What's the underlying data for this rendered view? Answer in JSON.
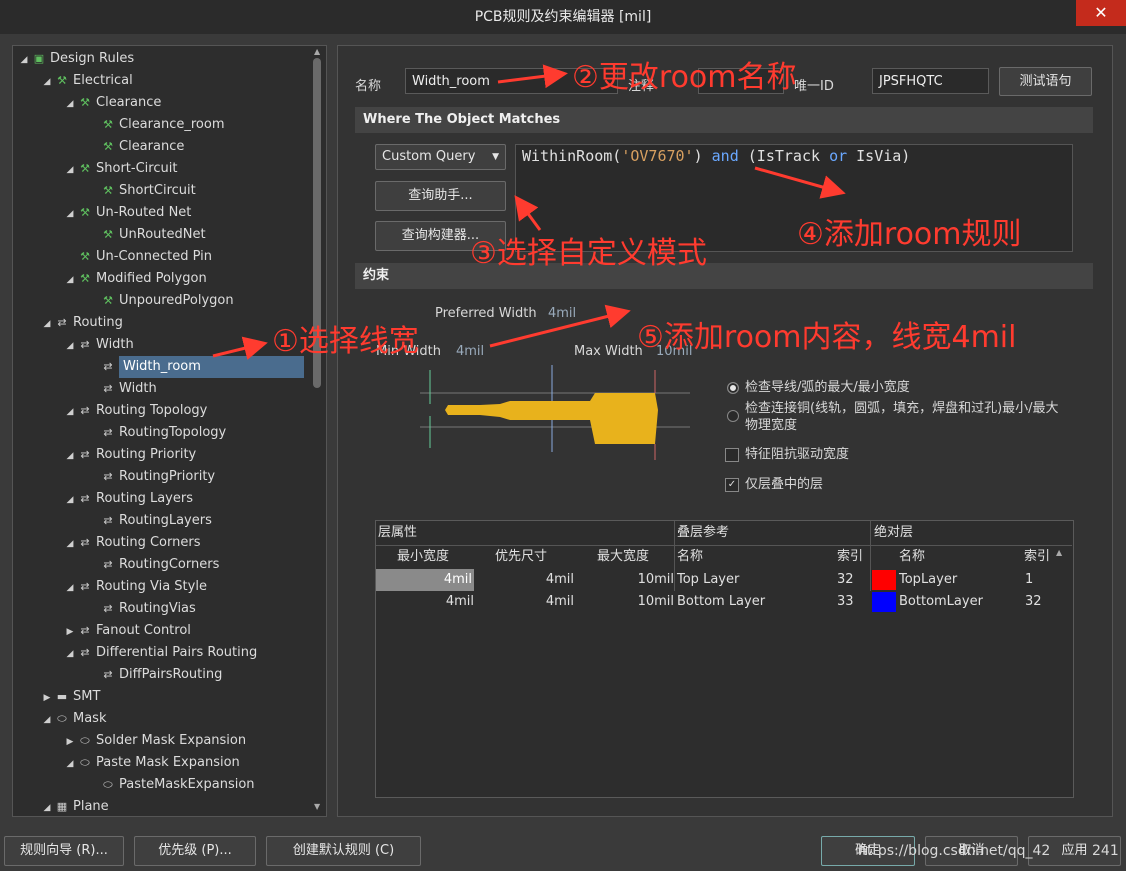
{
  "window": {
    "title": "PCB规则及约束编辑器 [mil]",
    "close": "✕"
  },
  "tree": [
    {
      "label": "Design Rules",
      "level": 0,
      "arrow": "◢",
      "icon": "rules-folder"
    },
    {
      "label": "Electrical",
      "level": 1,
      "arrow": "◢",
      "icon": "rule"
    },
    {
      "label": "Clearance",
      "level": 2,
      "arrow": "◢",
      "icon": "rule"
    },
    {
      "label": "Clearance_room",
      "level": 3,
      "arrow": "",
      "icon": "rule"
    },
    {
      "label": "Clearance",
      "level": 3,
      "arrow": "",
      "icon": "rule"
    },
    {
      "label": "Short-Circuit",
      "level": 2,
      "arrow": "◢",
      "icon": "rule"
    },
    {
      "label": "ShortCircuit",
      "level": 3,
      "arrow": "",
      "icon": "rule"
    },
    {
      "label": "Un-Routed Net",
      "level": 2,
      "arrow": "◢",
      "icon": "rule"
    },
    {
      "label": "UnRoutedNet",
      "level": 3,
      "arrow": "",
      "icon": "rule"
    },
    {
      "label": "Un-Connected Pin",
      "level": 2,
      "arrow": "",
      "icon": "rule"
    },
    {
      "label": "Modified Polygon",
      "level": 2,
      "arrow": "◢",
      "icon": "rule"
    },
    {
      "label": "UnpouredPolygon",
      "level": 3,
      "arrow": "",
      "icon": "rule"
    },
    {
      "label": "Routing",
      "level": 1,
      "arrow": "◢",
      "icon": "routing"
    },
    {
      "label": "Width",
      "level": 2,
      "arrow": "◢",
      "icon": "routing"
    },
    {
      "label": "Width_room",
      "level": 3,
      "arrow": "",
      "icon": "routing",
      "selected": true
    },
    {
      "label": "Width",
      "level": 3,
      "arrow": "",
      "icon": "routing"
    },
    {
      "label": "Routing Topology",
      "level": 2,
      "arrow": "◢",
      "icon": "routing"
    },
    {
      "label": "RoutingTopology",
      "level": 3,
      "arrow": "",
      "icon": "routing"
    },
    {
      "label": "Routing Priority",
      "level": 2,
      "arrow": "◢",
      "icon": "routing"
    },
    {
      "label": "RoutingPriority",
      "level": 3,
      "arrow": "",
      "icon": "routing"
    },
    {
      "label": "Routing Layers",
      "level": 2,
      "arrow": "◢",
      "icon": "routing"
    },
    {
      "label": "RoutingLayers",
      "level": 3,
      "arrow": "",
      "icon": "routing"
    },
    {
      "label": "Routing Corners",
      "level": 2,
      "arrow": "◢",
      "icon": "routing"
    },
    {
      "label": "RoutingCorners",
      "level": 3,
      "arrow": "",
      "icon": "routing"
    },
    {
      "label": "Routing Via Style",
      "level": 2,
      "arrow": "◢",
      "icon": "routing"
    },
    {
      "label": "RoutingVias",
      "level": 3,
      "arrow": "",
      "icon": "routing"
    },
    {
      "label": "Fanout Control",
      "level": 2,
      "arrow": "▶",
      "icon": "routing"
    },
    {
      "label": "Differential Pairs Routing",
      "level": 2,
      "arrow": "◢",
      "icon": "routing"
    },
    {
      "label": "DiffPairsRouting",
      "level": 3,
      "arrow": "",
      "icon": "routing"
    },
    {
      "label": "SMT",
      "level": 1,
      "arrow": "▶",
      "icon": "smt"
    },
    {
      "label": "Mask",
      "level": 1,
      "arrow": "◢",
      "icon": "mask"
    },
    {
      "label": "Solder Mask Expansion",
      "level": 2,
      "arrow": "▶",
      "icon": "mask"
    },
    {
      "label": "Paste Mask Expansion",
      "level": 2,
      "arrow": "◢",
      "icon": "mask"
    },
    {
      "label": "PasteMaskExpansion",
      "level": 3,
      "arrow": "",
      "icon": "mask"
    },
    {
      "label": "Plane",
      "level": 1,
      "arrow": "◢",
      "icon": "plane"
    }
  ],
  "form": {
    "name_label": "名称",
    "name_value": "Width_room",
    "comment_label": "注释",
    "comment_value": "",
    "uid_label": "唯一ID",
    "uid_value": "JPSFHQTC",
    "test_button": "测试语句"
  },
  "where": {
    "header": "Where The Object Matches",
    "query_type": "Custom Query",
    "helper_button": "查询助手...",
    "builder_button": "查询构建器...",
    "query_parts": {
      "p1": "WithinRoom(",
      "p2": "'OV7670'",
      "p3": ") ",
      "p4": "and",
      "p5": " (IsTrack ",
      "p6": "or",
      "p7": " IsVia)"
    }
  },
  "constraints": {
    "header": "约束",
    "preferred_label": "Preferred Width",
    "preferred_value": "4mil",
    "min_label": "Min Width",
    "min_value": "4mil",
    "max_label": "Max Width",
    "max_value": "10mil",
    "opt1": "检查导线/弧的最大/最小宽度",
    "opt2a": "检查连接铜(线轨，圆弧，填充，焊盘和过孔)最小/最大",
    "opt2b": "物理宽度",
    "chk1": "特征阻抗驱动宽度",
    "chk2": "仅层叠中的层"
  },
  "table": {
    "group1": "层属性",
    "group2": "叠层参考",
    "group3": "绝对层",
    "cols": [
      "最小宽度",
      "优先尺寸",
      "最大宽度",
      "名称",
      "索引",
      "名称",
      "索引"
    ],
    "rows": [
      {
        "min": "4mil",
        "pref": "4mil",
        "max": "10mil",
        "stack_name": "Top Layer",
        "stack_idx": "32",
        "color": "#ff0000",
        "abs_name": "TopLayer",
        "abs_idx": "1"
      },
      {
        "min": "4mil",
        "pref": "4mil",
        "max": "10mil",
        "stack_name": "Bottom Layer",
        "stack_idx": "33",
        "color": "#0000ff",
        "abs_name": "BottomLayer",
        "abs_idx": "32"
      }
    ]
  },
  "footer": {
    "wizard": "规则向导 (R)...",
    "priority": "优先级 (P)...",
    "default_rules": "创建默认规则 (C)",
    "ok": "确定",
    "cancel": "取消",
    "apply": "应用"
  },
  "watermark": "https://blog.csdn.net/qq_42",
  "watermark_tail": "241",
  "annotations": {
    "a1": "①选择线宽",
    "a2": "②更改room名称",
    "a3": "③选择自定义模式",
    "a4": "④添加room规则",
    "a5": "⑤添加room内容，线宽4mil"
  },
  "colors": {
    "annotation": "#ff3b2f",
    "trace": "#e8b21c",
    "selection": "#4a6c8e"
  }
}
